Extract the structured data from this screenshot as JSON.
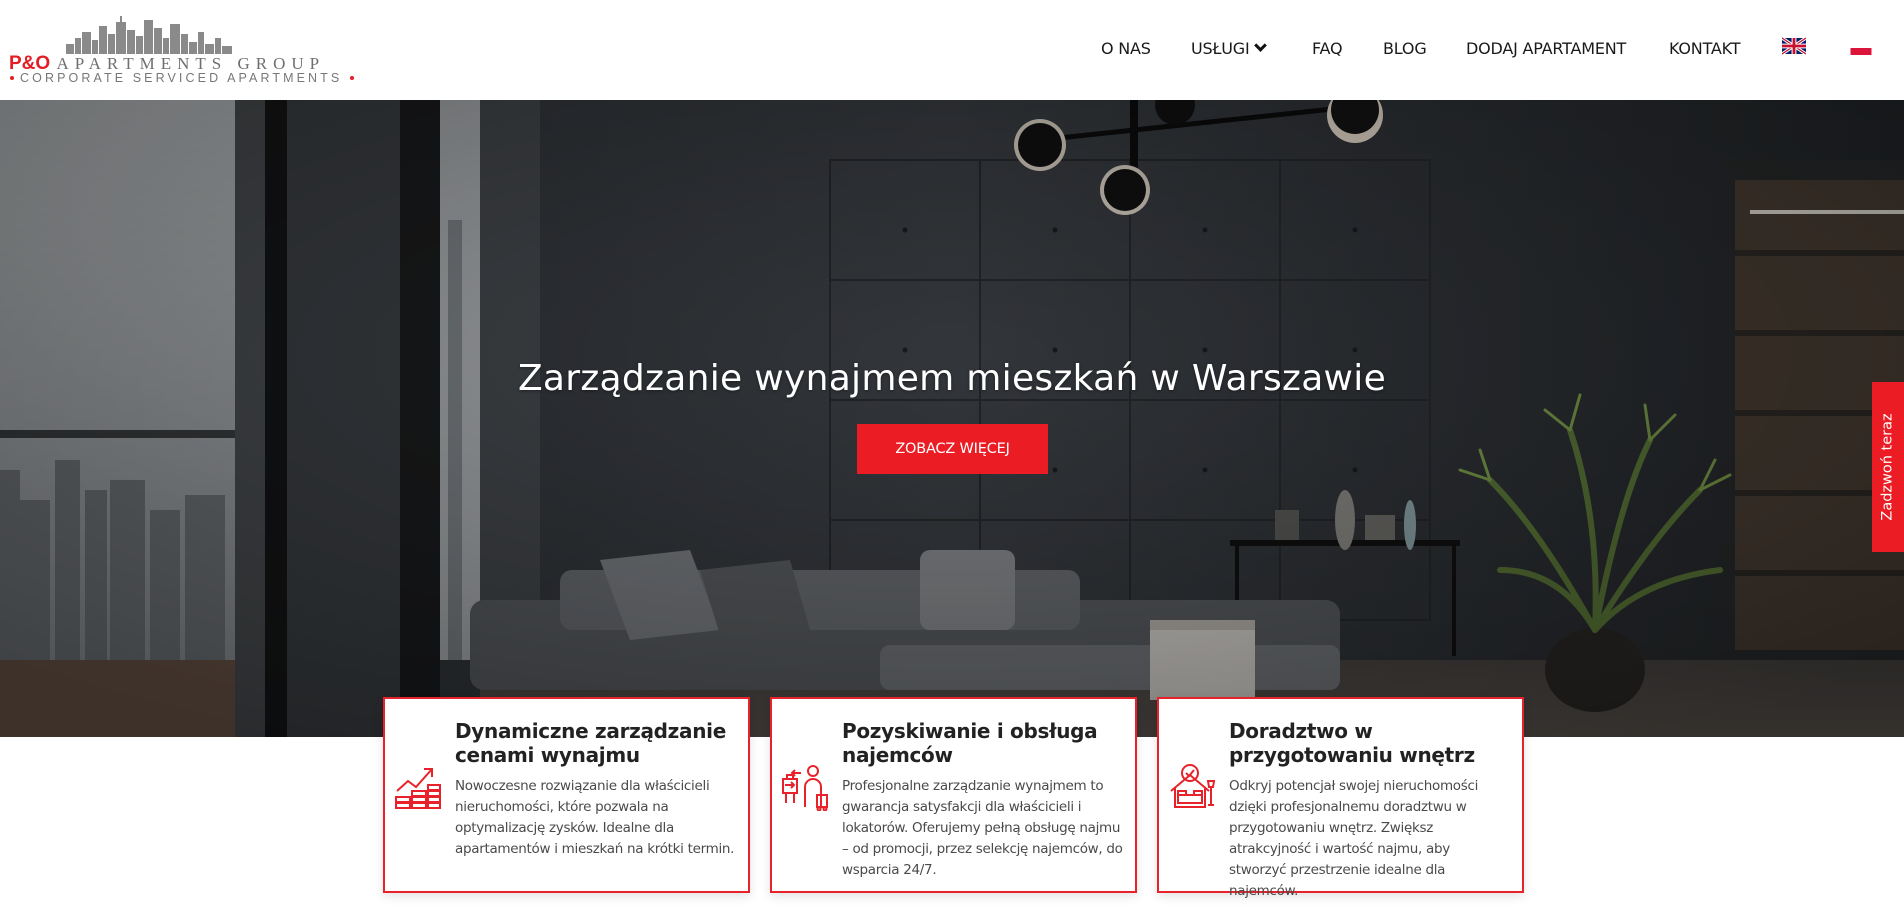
{
  "brand": {
    "name_part1": "P&O",
    "name_part2": "APARTMENTS GROUP",
    "tagline": "CORPORATE SERVICED APARTMENTS"
  },
  "nav": {
    "items": [
      {
        "label": "O NAS"
      },
      {
        "label": "USŁUGI",
        "has_dropdown": true
      },
      {
        "label": "FAQ"
      },
      {
        "label": "BLOG"
      },
      {
        "label": "DODAJ APARTAMENT"
      },
      {
        "label": "KONTAKT"
      }
    ],
    "languages": [
      "en-flag-icon",
      "pl-flag-icon"
    ]
  },
  "hero": {
    "title": "Zarządzanie wynajmem mieszkań w Warszawie",
    "cta_label": "ZOBACZ WIĘCEJ"
  },
  "call_tab": {
    "label": "Zadzwoń teraz"
  },
  "features": [
    {
      "icon": "chart-coins-icon",
      "title": "Dynamiczne zarządzanie cenami wynajmu",
      "text": "Nowoczesne rozwiązanie dla właścicieli nieruchomości, które pozwala na optymalizację zysków. Idealne dla apartamentów i mieszkań na krótki termin."
    },
    {
      "icon": "tenant-luggage-icon",
      "title": "Pozyskiwanie i obsługa najemców",
      "text": "Profesjonalne zarządzanie wynajmem to gwarancja satysfakcji dla właścicieli i lokatorów. Oferujemy pełną obsługę najmu – od promocji, przez selekcję najemców, do wsparcia 24/7."
    },
    {
      "icon": "bedroom-design-icon",
      "title": "Doradztwo w przygotowaniu wnętrz",
      "text": "Odkryj potencjał swojej nieruchomości dzięki profesjonalnemu doradztwu w przygotowaniu wnętrz. Zwiększ atrakcyjność i wartość najmu, aby stworzyć przestrzenie idealne dla najemców."
    }
  ],
  "colors": {
    "accent": "#ec1c24",
    "nav_text": "#1a1a1a",
    "logo_grey": "#6f6f6f"
  }
}
